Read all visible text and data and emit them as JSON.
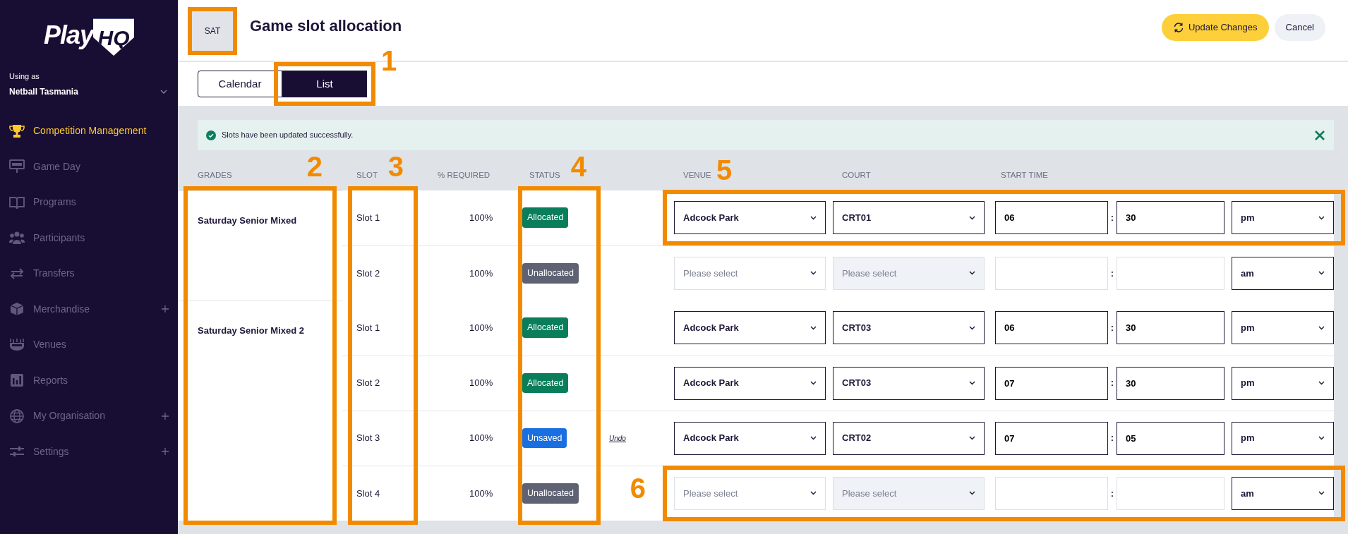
{
  "sidebar": {
    "logo": {
      "word": "Play",
      "shield": "HQ"
    },
    "using_as_label": "Using as",
    "organisation": "Netball Tasmania",
    "items": [
      {
        "label": "Competition Management",
        "selected": true,
        "expandable": false
      },
      {
        "label": "Game Day",
        "selected": false,
        "expandable": false
      },
      {
        "label": "Programs",
        "selected": false,
        "expandable": false
      },
      {
        "label": "Participants",
        "selected": false,
        "expandable": false
      },
      {
        "label": "Transfers",
        "selected": false,
        "expandable": false
      },
      {
        "label": "Merchandise",
        "selected": false,
        "expandable": true
      },
      {
        "label": "Venues",
        "selected": false,
        "expandable": false
      },
      {
        "label": "Reports",
        "selected": false,
        "expandable": false
      },
      {
        "label": "My Organisation",
        "selected": false,
        "expandable": true
      },
      {
        "label": "Settings",
        "selected": false,
        "expandable": true
      }
    ]
  },
  "header": {
    "day_badge": "SAT",
    "title": "Game slot allocation",
    "buttons": [
      {
        "label": "Update Changes",
        "kind": "primary"
      },
      {
        "label": "Cancel",
        "kind": "secondary"
      }
    ]
  },
  "view_tabs": [
    {
      "label": "Calendar",
      "selected": false
    },
    {
      "label": "List",
      "selected": true
    }
  ],
  "alert": {
    "text": "Slots have been updated successfully."
  },
  "columns": [
    "GRADES",
    "SLOT",
    "% REQUIRED",
    "STATUS",
    "VENUE",
    "COURT",
    "START TIME"
  ],
  "grades": [
    {
      "name": "Saturday Senior Mixed",
      "slots": [
        {
          "slot": "Slot 1",
          "required": "100%",
          "status": {
            "label": "Allocated",
            "kind": "allocated"
          },
          "venue": {
            "value": "Adcock Park"
          },
          "court": {
            "value": "CRT01",
            "disabled": false
          },
          "hour": "06",
          "separator": ":",
          "minute": "30",
          "meridiem": "pm"
        },
        {
          "slot": "Slot 2",
          "required": "100%",
          "status": {
            "label": "Unallocated",
            "kind": "unallocated"
          },
          "venue": {
            "placeholder": "Please select"
          },
          "court": {
            "placeholder": "Please select",
            "disabled": true
          },
          "separator": ":",
          "meridiem": "am"
        }
      ]
    },
    {
      "name": "Saturday Senior Mixed 2",
      "slots": [
        {
          "slot": "Slot 1",
          "required": "100%",
          "status": {
            "label": "Allocated",
            "kind": "allocated"
          },
          "venue": {
            "value": "Adcock Park"
          },
          "court": {
            "value": "CRT03",
            "disabled": false
          },
          "hour": "06",
          "separator": ":",
          "minute": "30",
          "meridiem": "pm"
        },
        {
          "slot": "Slot 2",
          "required": "100%",
          "status": {
            "label": "Allocated",
            "kind": "allocated"
          },
          "venue": {
            "value": "Adcock Park"
          },
          "court": {
            "value": "CRT03",
            "disabled": false
          },
          "hour": "07",
          "separator": ":",
          "minute": "30",
          "meridiem": "pm"
        },
        {
          "slot": "Slot 3",
          "required": "100%",
          "status": {
            "label": "Unsaved",
            "kind": "unsaved"
          },
          "undo": "Undo",
          "venue": {
            "value": "Adcock Park"
          },
          "court": {
            "value": "CRT02",
            "disabled": false
          },
          "hour": "07",
          "separator": ":",
          "minute": "05",
          "meridiem": "pm"
        },
        {
          "slot": "Slot 4",
          "required": "100%",
          "status": {
            "label": "Unallocated",
            "kind": "unallocated"
          },
          "venue": {
            "placeholder": "Please select"
          },
          "court": {
            "placeholder": "Please select",
            "disabled": true
          },
          "separator": ":",
          "meridiem": "am"
        }
      ]
    }
  ],
  "callouts": [
    {
      "kind": "frame"
    },
    {
      "kind": "numbered",
      "number": "1"
    },
    {
      "kind": "numbered",
      "number": "2"
    },
    {
      "kind": "numbered",
      "number": "3"
    },
    {
      "kind": "numbered",
      "number": "4"
    },
    {
      "kind": "numbered",
      "number": "5"
    },
    {
      "kind": "numbered",
      "number": "6"
    }
  ]
}
